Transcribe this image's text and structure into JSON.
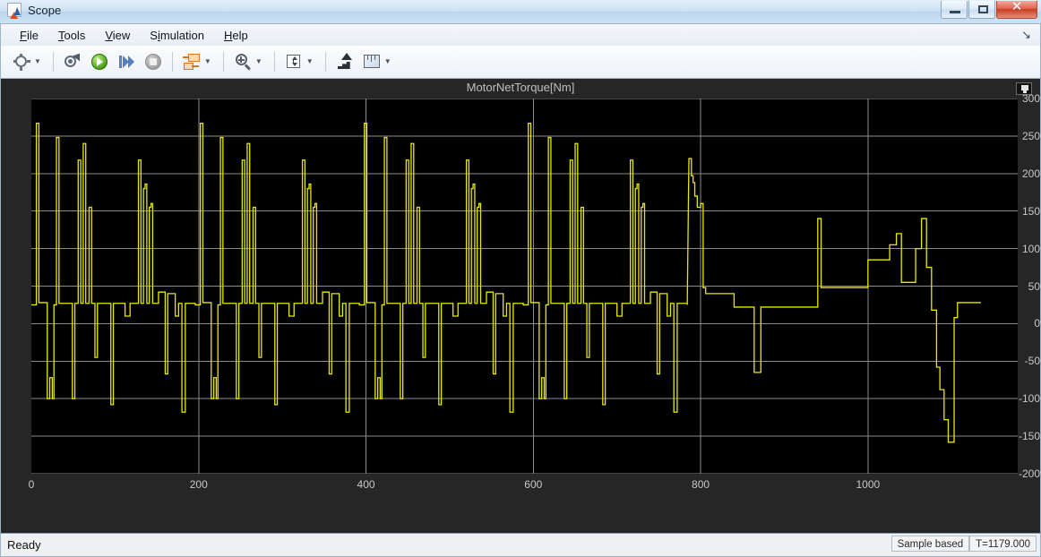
{
  "window": {
    "title": "Scope",
    "app_icon": "matlab-scope-icon",
    "buttons": {
      "minimize": "minimize-button",
      "maximize": "maximize-button",
      "close": "✕"
    }
  },
  "menubar": {
    "items": [
      {
        "label": "File",
        "mnemonic": "F"
      },
      {
        "label": "Tools",
        "mnemonic": "T"
      },
      {
        "label": "View",
        "mnemonic": "V"
      },
      {
        "label": "Simulation",
        "mnemonic": "S"
      },
      {
        "label": "Help",
        "mnemonic": "H"
      }
    ],
    "dock_control": "↘"
  },
  "toolbar": {
    "items": [
      {
        "name": "configuration-properties-icon",
        "has_dropdown": true
      },
      {
        "name": "simulink-model-icon",
        "has_dropdown": false
      },
      {
        "name": "run-icon",
        "has_dropdown": false
      },
      {
        "name": "step-forward-icon",
        "has_dropdown": false
      },
      {
        "name": "stop-icon",
        "has_dropdown": false
      },
      {
        "name": "layout-icon",
        "has_dropdown": true
      },
      {
        "name": "zoom-in-icon",
        "has_dropdown": true
      },
      {
        "name": "autoscale-icon",
        "has_dropdown": true
      },
      {
        "name": "trigger-icon",
        "has_dropdown": false
      },
      {
        "name": "measurements-icon",
        "has_dropdown": true
      }
    ]
  },
  "scope": {
    "title": "MotorNetTorque[Nm]",
    "legend_button": "legend-toggle-button",
    "background": "#262626",
    "plot_background": "#000000",
    "grid_color": "#8c8c8c",
    "trace_color": "#e8e800"
  },
  "statusbar": {
    "ready_text": "Ready",
    "frame_mode": "Sample based",
    "time_label": "T=1179.000"
  },
  "chart_data": {
    "type": "line",
    "title": "MotorNetTorque[Nm]",
    "xlabel": "",
    "ylabel": "",
    "xlim": [
      0,
      1179
    ],
    "ylim": [
      -200,
      300
    ],
    "xticks": [
      0,
      200,
      400,
      600,
      800,
      1000
    ],
    "yticks": [
      -200,
      -150,
      -100,
      -50,
      0,
      50,
      100,
      150,
      200,
      250,
      300
    ],
    "grid": true,
    "legend": false,
    "series": [
      {
        "name": "MotorNetTorque[Nm]",
        "color": "#e8e800",
        "comment": "Drive-cycle motor net torque, step/impulse shaped; pattern of 4 near-identical cycles of ~196 s then a final differing segment.",
        "cycle_length": 196,
        "cycle_count": 4,
        "cycle_points": [
          [
            0,
            25
          ],
          [
            6,
            25
          ],
          [
            6,
            267
          ],
          [
            9,
            267
          ],
          [
            9,
            28
          ],
          [
            19,
            28
          ],
          [
            19,
            -100
          ],
          [
            22,
            -100
          ],
          [
            22,
            -72
          ],
          [
            25,
            -72
          ],
          [
            25,
            -100
          ],
          [
            27,
            -100
          ],
          [
            27,
            25
          ],
          [
            30,
            25
          ],
          [
            30,
            248
          ],
          [
            33,
            248
          ],
          [
            33,
            27
          ],
          [
            49,
            27
          ],
          [
            49,
            -100
          ],
          [
            52,
            -100
          ],
          [
            52,
            27
          ],
          [
            56,
            27
          ],
          [
            56,
            218
          ],
          [
            59,
            218
          ],
          [
            59,
            27
          ],
          [
            62,
            27
          ],
          [
            62,
            240
          ],
          [
            65,
            240
          ],
          [
            65,
            27
          ],
          [
            69,
            27
          ],
          [
            69,
            155
          ],
          [
            72,
            155
          ],
          [
            72,
            27
          ],
          [
            76,
            27
          ],
          [
            76,
            -45
          ],
          [
            79,
            -45
          ],
          [
            79,
            27
          ],
          [
            95,
            27
          ],
          [
            95,
            -108
          ],
          [
            98,
            -108
          ],
          [
            98,
            27
          ],
          [
            112,
            27
          ],
          [
            112,
            10
          ],
          [
            118,
            10
          ],
          [
            118,
            27
          ],
          [
            128,
            27
          ],
          [
            128,
            218
          ],
          [
            131,
            218
          ],
          [
            131,
            27
          ],
          [
            134,
            27
          ],
          [
            134,
            180
          ],
          [
            136,
            180
          ],
          [
            136,
            186
          ],
          [
            138,
            186
          ],
          [
            138,
            27
          ],
          [
            141,
            27
          ],
          [
            141,
            155
          ],
          [
            143,
            155
          ],
          [
            143,
            160
          ],
          [
            145,
            160
          ],
          [
            145,
            27
          ],
          [
            152,
            27
          ],
          [
            152,
            42
          ],
          [
            160,
            42
          ],
          [
            160,
            -67
          ],
          [
            163,
            -67
          ],
          [
            163,
            40
          ],
          [
            172,
            40
          ],
          [
            172,
            10
          ],
          [
            176,
            10
          ],
          [
            176,
            27
          ],
          [
            180,
            27
          ],
          [
            180,
            -118
          ],
          [
            184,
            -118
          ],
          [
            184,
            27
          ],
          [
            196,
            27
          ]
        ],
        "tail_points": [
          [
            784,
            25
          ],
          [
            786,
            220
          ],
          [
            789,
            220
          ],
          [
            789,
            197
          ],
          [
            791,
            197
          ],
          [
            791,
            188
          ],
          [
            793,
            188
          ],
          [
            793,
            170
          ],
          [
            796,
            170
          ],
          [
            796,
            155
          ],
          [
            800,
            155
          ],
          [
            800,
            160
          ],
          [
            803,
            160
          ],
          [
            803,
            48
          ],
          [
            806,
            48
          ],
          [
            806,
            40
          ],
          [
            840,
            40
          ],
          [
            840,
            22
          ],
          [
            864,
            22
          ],
          [
            864,
            -65
          ],
          [
            872,
            -65
          ],
          [
            872,
            22
          ],
          [
            940,
            22
          ],
          [
            940,
            140
          ],
          [
            944,
            140
          ],
          [
            944,
            48
          ],
          [
            1000,
            48
          ],
          [
            1000,
            85
          ],
          [
            1026,
            85
          ],
          [
            1026,
            105
          ],
          [
            1034,
            105
          ],
          [
            1034,
            120
          ],
          [
            1040,
            120
          ],
          [
            1040,
            55
          ],
          [
            1057,
            55
          ],
          [
            1057,
            100
          ],
          [
            1064,
            100
          ],
          [
            1064,
            140
          ],
          [
            1070,
            140
          ],
          [
            1070,
            75
          ],
          [
            1076,
            75
          ],
          [
            1076,
            18
          ],
          [
            1082,
            18
          ],
          [
            1082,
            -58
          ],
          [
            1086,
            -58
          ],
          [
            1086,
            -88
          ],
          [
            1091,
            -88
          ],
          [
            1091,
            -128
          ],
          [
            1096,
            -128
          ],
          [
            1096,
            -158
          ],
          [
            1103,
            -158
          ],
          [
            1103,
            8
          ],
          [
            1107,
            8
          ],
          [
            1107,
            28
          ],
          [
            1135,
            28
          ]
        ]
      }
    ]
  }
}
